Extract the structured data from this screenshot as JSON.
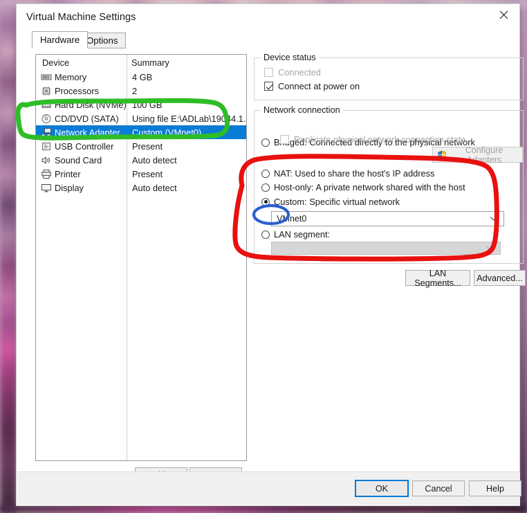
{
  "window": {
    "title": "Virtual Machine Settings",
    "close_icon": "close-icon"
  },
  "tabs": [
    {
      "label": "Hardware",
      "active": true
    },
    {
      "label": "Options",
      "active": false
    }
  ],
  "device_list": {
    "columns": {
      "device": "Device",
      "summary": "Summary"
    },
    "rows": [
      {
        "icon": "memory-icon",
        "name": "Memory",
        "summary": "4 GB",
        "selected": false
      },
      {
        "icon": "processor-icon",
        "name": "Processors",
        "summary": "2",
        "selected": false
      },
      {
        "icon": "hard-disk-icon",
        "name": "Hard Disk (NVMe)",
        "summary": "100 GB",
        "selected": false
      },
      {
        "icon": "cd-dvd-icon",
        "name": "CD/DVD (SATA)",
        "summary": "Using file E:\\ADLab\\19044.1…",
        "selected": false
      },
      {
        "icon": "network-adapter-icon",
        "name": "Network Adapter",
        "summary": "Custom (VMnet0)",
        "selected": true
      },
      {
        "icon": "usb-controller-icon",
        "name": "USB Controller",
        "summary": "Present",
        "selected": false
      },
      {
        "icon": "sound-card-icon",
        "name": "Sound Card",
        "summary": "Auto detect",
        "selected": false
      },
      {
        "icon": "printer-icon",
        "name": "Printer",
        "summary": "Present",
        "selected": false
      },
      {
        "icon": "display-icon",
        "name": "Display",
        "summary": "Auto detect",
        "selected": false
      }
    ],
    "add_label": "Add...",
    "remove_label": "Remove"
  },
  "device_status": {
    "group_title": "Device status",
    "connected_label": "Connected",
    "connected_checked": false,
    "connected_disabled": true,
    "connect_at_power_on_label": "Connect at power on",
    "connect_at_power_on_checked": true
  },
  "network_connection": {
    "group_title": "Network connection",
    "bridged_label": "Bridged: Connected directly to the physical network",
    "replicate_label": "Replicate physical network connection state",
    "configure_adapters_label": "Configure Adapters",
    "configure_adapters_icon": "shield-icon",
    "nat_label": "NAT: Used to share the host's IP address",
    "host_only_label": "Host-only: A private network shared with the host",
    "custom_label": "Custom: Specific virtual network",
    "custom_selected": true,
    "vmnet_value": "VMnet0",
    "lan_segment_label": "LAN segment:",
    "lan_segment_value": "",
    "lan_segments_button": "LAN Segments...",
    "advanced_button": "Advanced..."
  },
  "footer": {
    "ok_label": "OK",
    "cancel_label": "Cancel",
    "help_label": "Help"
  },
  "annotations": {
    "green_color": "#2fbd27",
    "red_color": "#e8110f",
    "blue_color": "#2b5fd0"
  }
}
